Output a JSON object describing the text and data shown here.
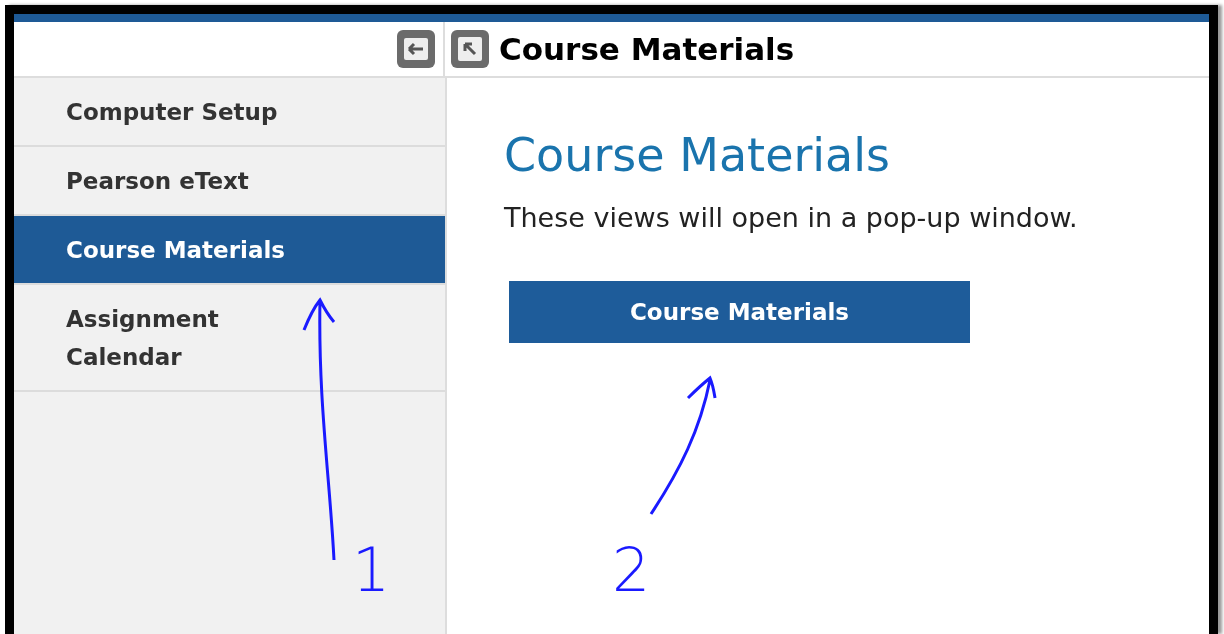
{
  "header": {
    "title": "Course Materials"
  },
  "sidebar": {
    "items": [
      {
        "label": "Computer Setup",
        "selected": false
      },
      {
        "label": "Pearson eText",
        "selected": false
      },
      {
        "label": "Course Materials",
        "selected": true
      },
      {
        "label": "Assignment Calendar",
        "selected": false
      }
    ]
  },
  "content": {
    "heading": "Course Materials",
    "text": "These views will open in a pop-up window.",
    "button": "Course Materials"
  },
  "annotations": [
    {
      "label": "1"
    },
    {
      "label": "2"
    }
  ]
}
